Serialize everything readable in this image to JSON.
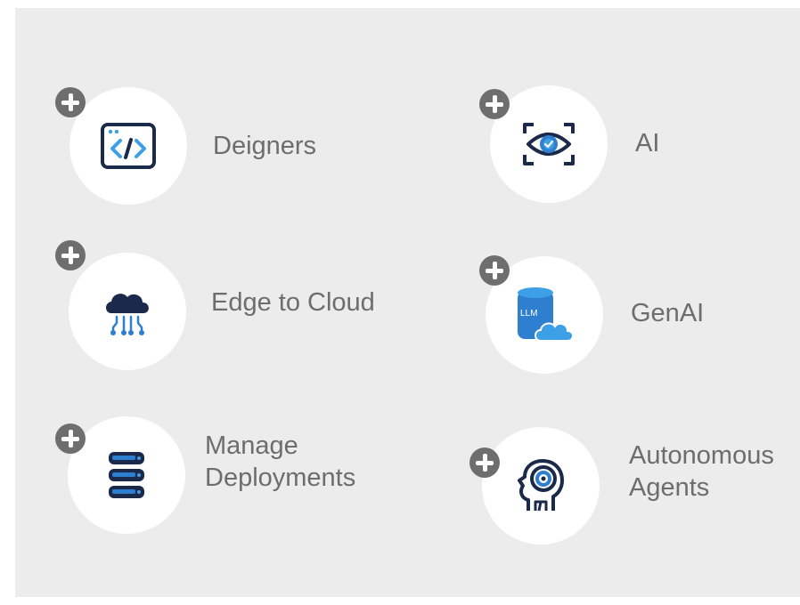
{
  "items": [
    {
      "label_lines": [
        "Deigners"
      ],
      "icon": "code-window-icon"
    },
    {
      "label_lines": [
        "AI"
      ],
      "icon": "eye-scan-icon"
    },
    {
      "label_lines": [
        "Edge to Cloud"
      ],
      "icon": "cloud-network-icon"
    },
    {
      "label_lines": [
        "GenAI"
      ],
      "icon": "llm-database-cloud-icon",
      "icon_text": "LLM"
    },
    {
      "label_lines": [
        "Manage",
        "Deployments"
      ],
      "icon": "server-stack-icon"
    },
    {
      "label_lines": [
        "Autonomous",
        "Agents"
      ],
      "icon": "robot-head-icon"
    }
  ],
  "colors": {
    "panel_bg": "#ececec",
    "circle_bg": "#ffffff",
    "plus_bg": "#6e6e6e",
    "label_text": "#6d6d6d",
    "icon_navy": "#1b2a4a",
    "icon_blue": "#2f7fd0",
    "icon_light_blue": "#3da0e6"
  }
}
